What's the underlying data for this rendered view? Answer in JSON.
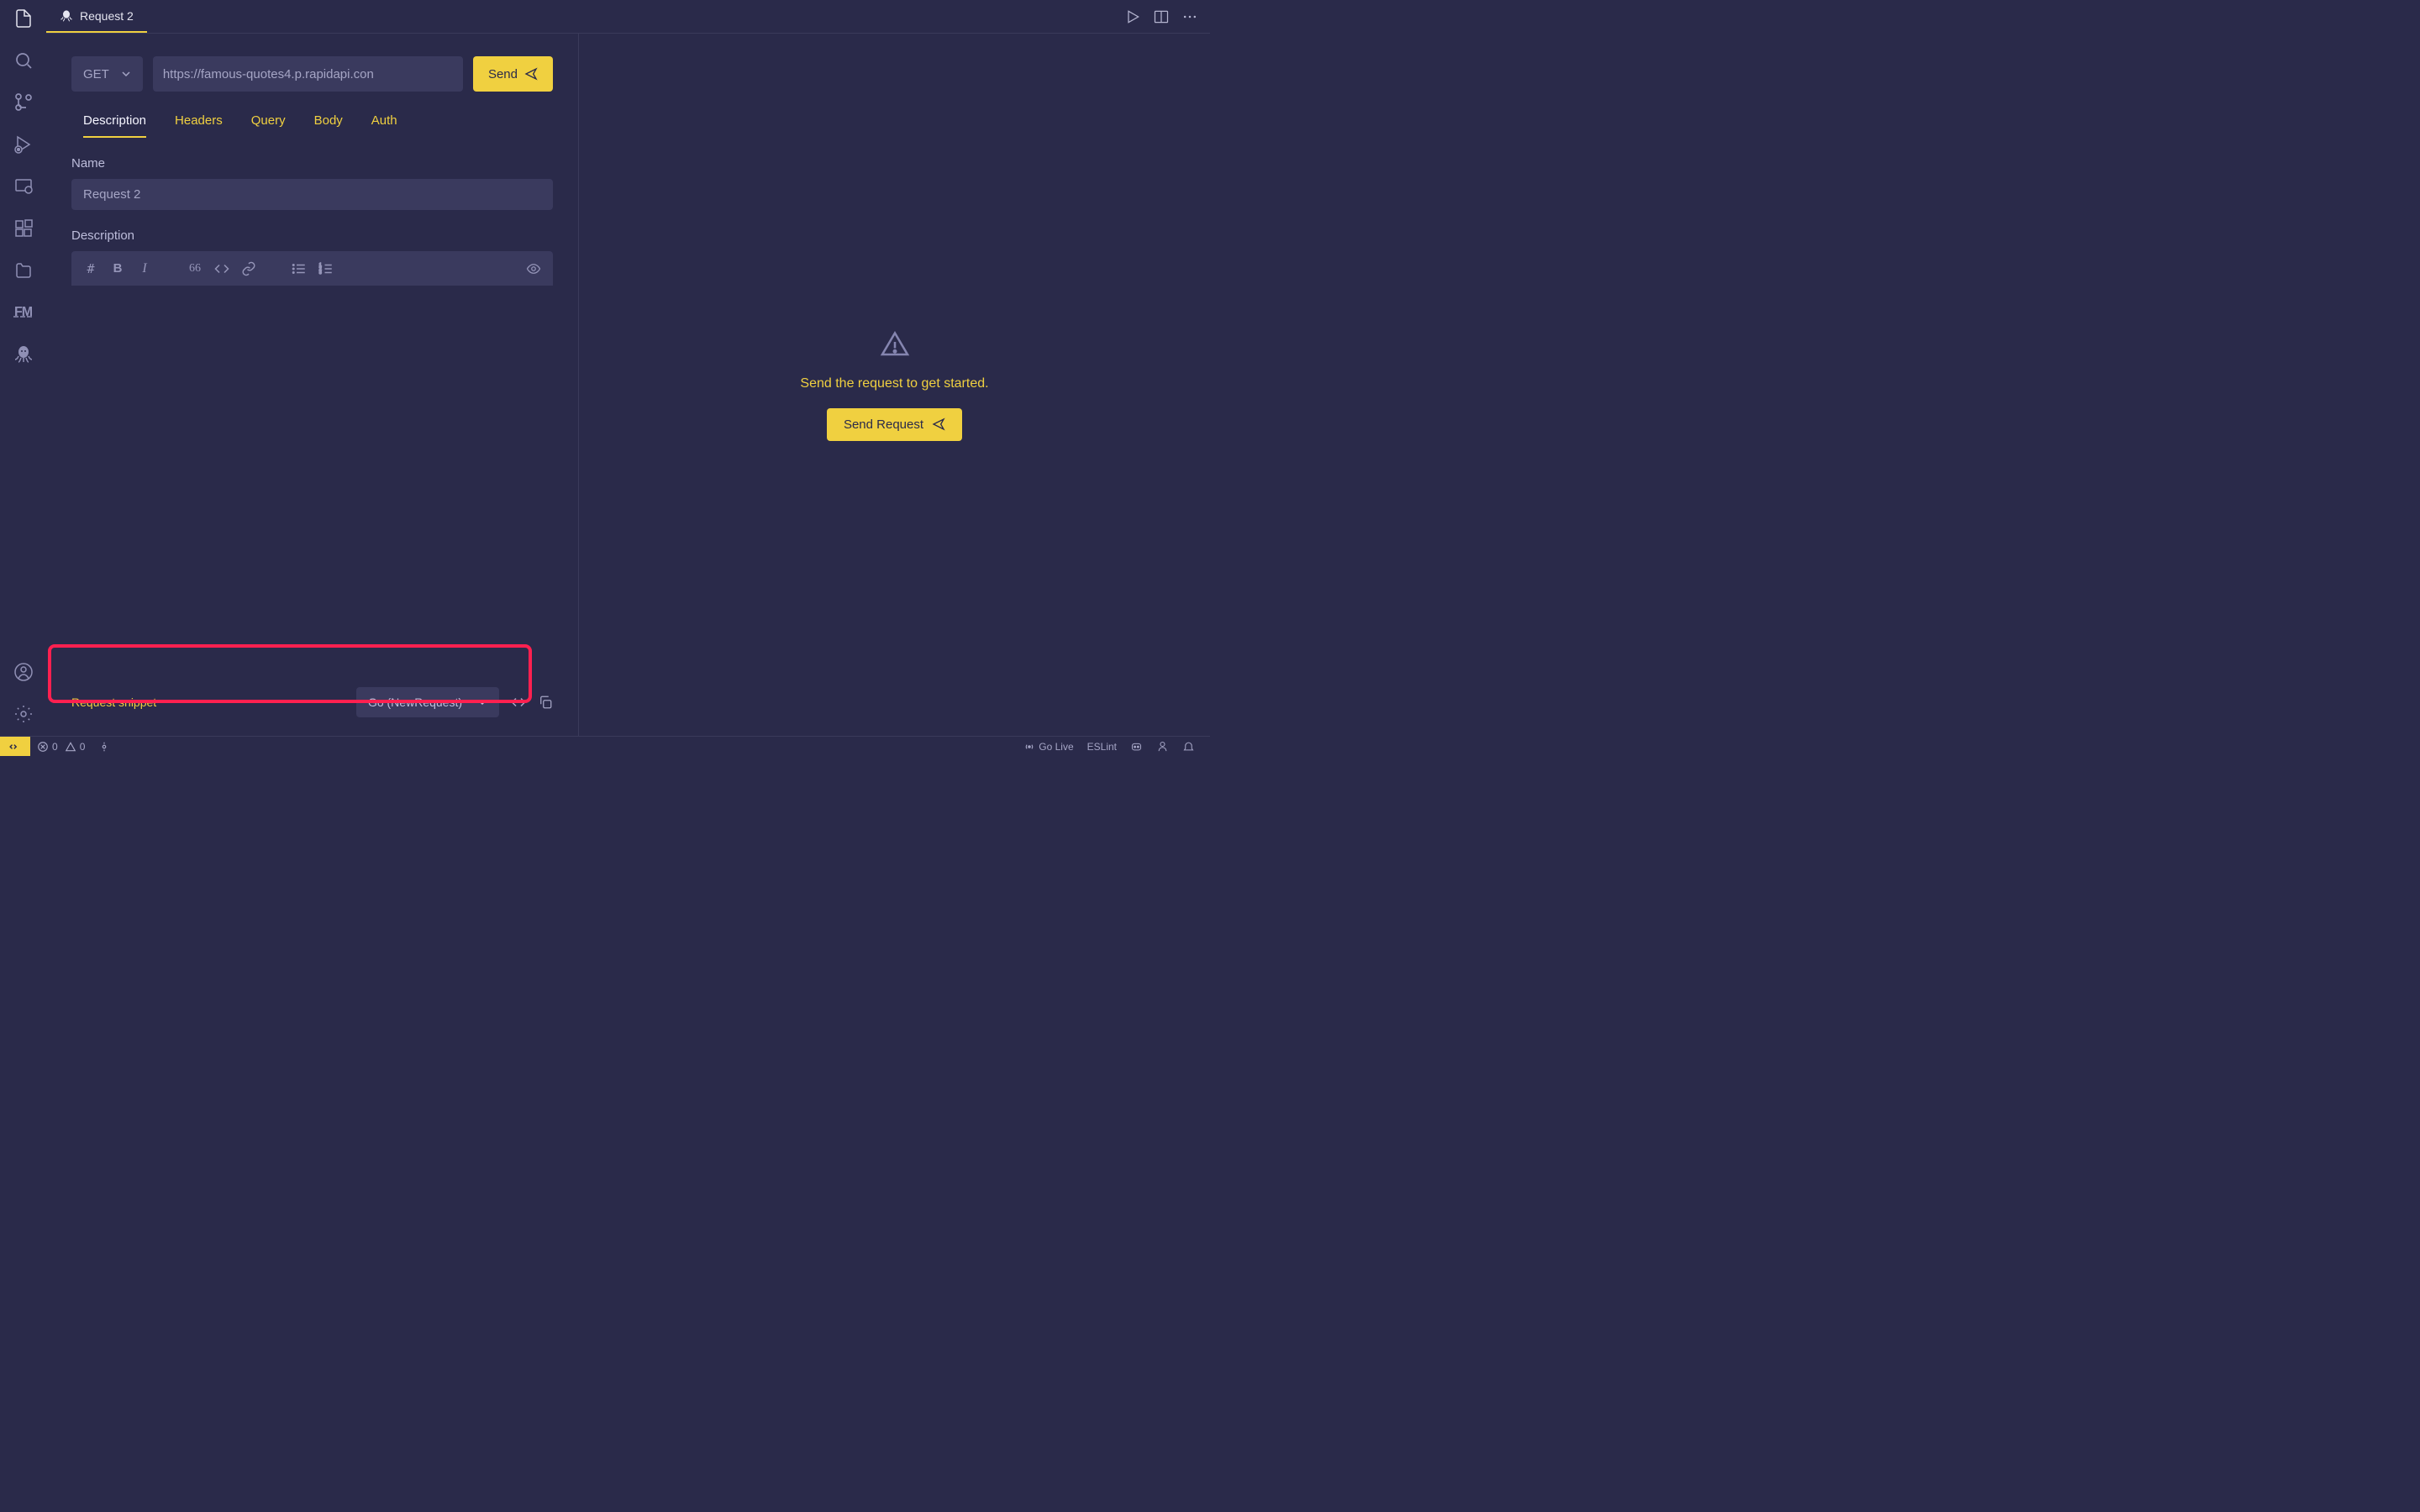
{
  "tab": {
    "title": "Request 2"
  },
  "request": {
    "method": "GET",
    "url": "https://famous-quotes4.p.rapidapi.con",
    "send_label": "Send"
  },
  "req_tabs": {
    "description": "Description",
    "headers": "Headers",
    "query": "Query",
    "body": "Body",
    "auth": "Auth"
  },
  "fields": {
    "name_label": "Name",
    "name_value": "Request 2",
    "description_label": "Description"
  },
  "snippet": {
    "label": "Request snippet",
    "selected": "Go (NewRequest)"
  },
  "response": {
    "empty_text": "Send the request to get started.",
    "button_label": "Send Request"
  },
  "statusbar": {
    "errors": "0",
    "warnings": "0",
    "go_live": "Go Live",
    "eslint": "ESLint"
  },
  "activity_fm": "FM"
}
